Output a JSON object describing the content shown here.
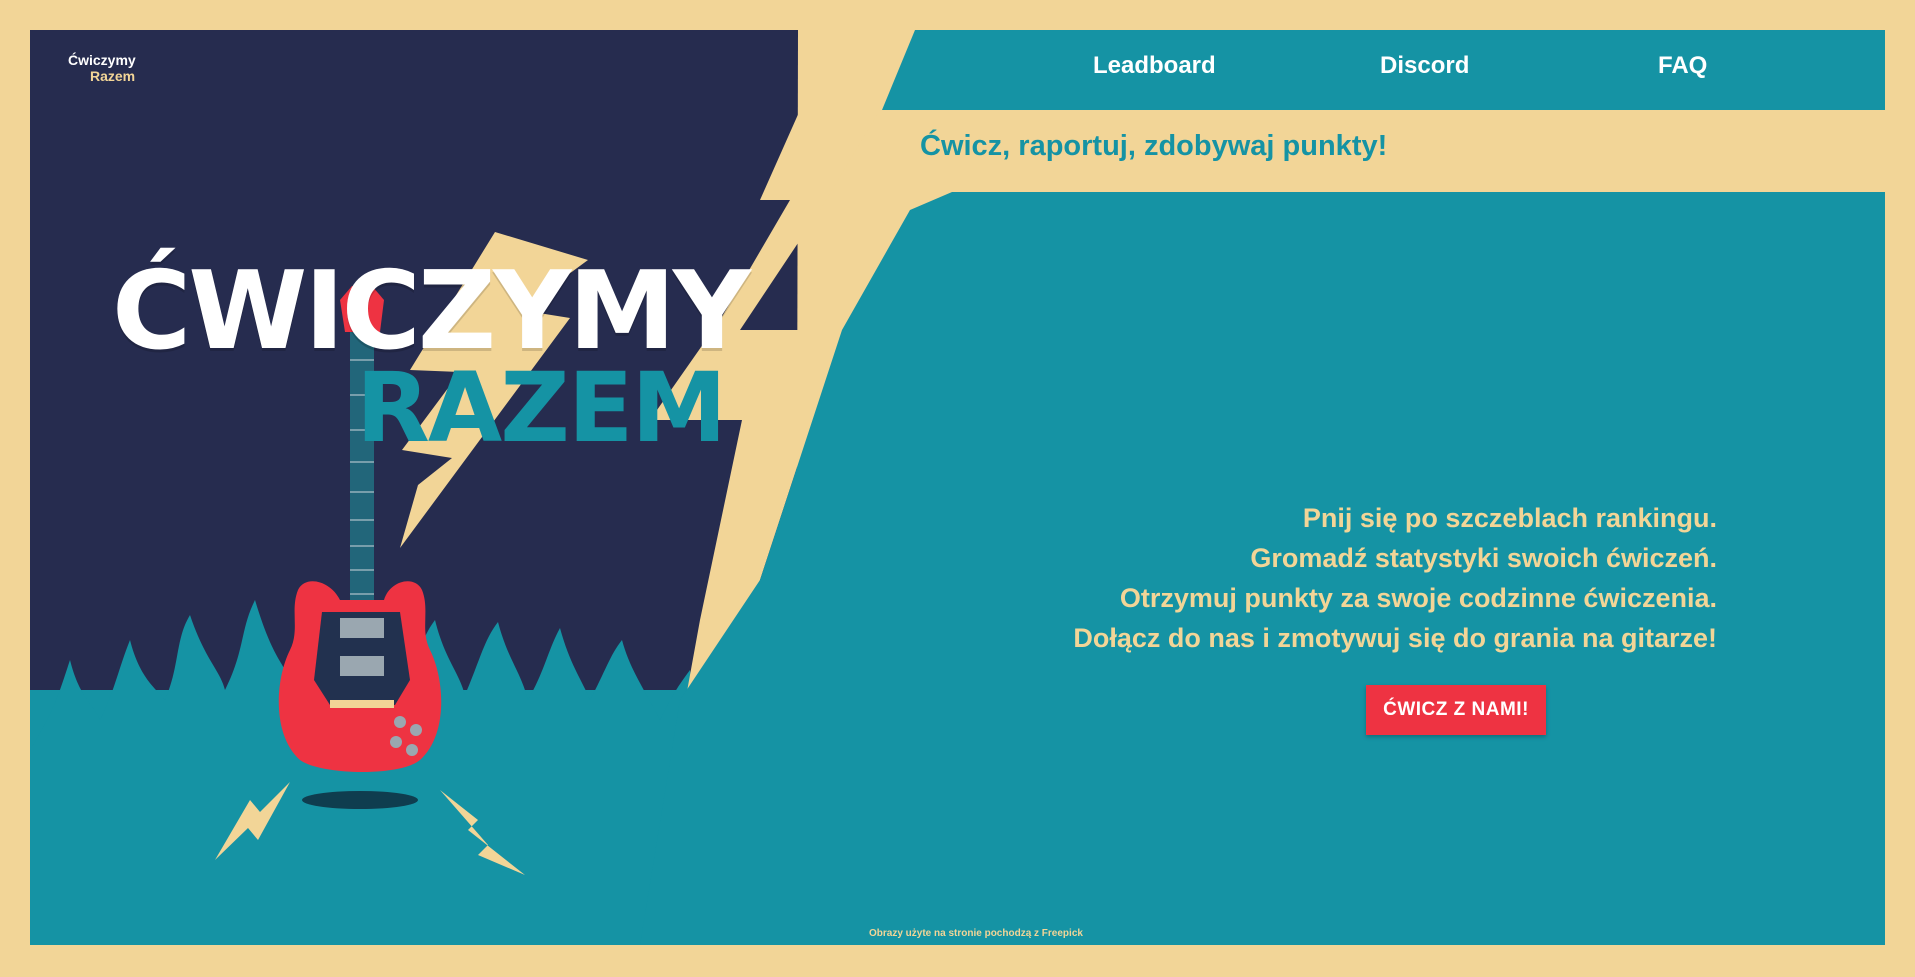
{
  "logo": {
    "line1": "Ćwiczymy",
    "line2": "Razem"
  },
  "hero": {
    "title_line1": "ĆWICZYMY",
    "title_line2": "RAZEM"
  },
  "nav": {
    "items": [
      {
        "label": "Leadboard"
      },
      {
        "label": "Discord"
      },
      {
        "label": "FAQ"
      }
    ]
  },
  "tagline": "Ćwicz, raportuj, zdobywaj punkty!",
  "features": [
    "Pnij się po szczeblach rankingu.",
    "Gromadź statystyki swoich ćwiczeń.",
    "Otrzymuj punkty za swoje codzinne ćwiczenia.",
    "Dołącz do nas i zmotywuj się do grania na gitarze!"
  ],
  "cta": {
    "label": "ĆWICZ Z NAMI!"
  },
  "credit": "Obrazy użyte na stronie pochodzą z Freepick",
  "colors": {
    "cream": "#f2d597",
    "navy": "#262c4f",
    "teal": "#1593a4",
    "red": "#ee3342"
  }
}
